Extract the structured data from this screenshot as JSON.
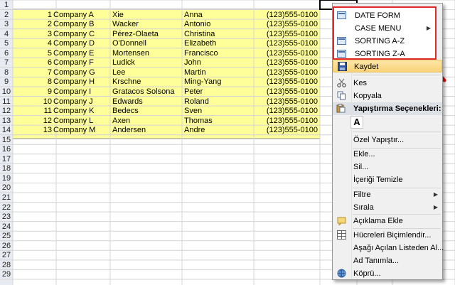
{
  "rows": [
    {
      "num": "1",
      "company": "Company A",
      "last": "Xie",
      "first": "Anna",
      "phone": "(123)555-0100"
    },
    {
      "num": "2",
      "company": "Company B",
      "last": "Wacker",
      "first": "Antonio",
      "phone": "(123)555-0100"
    },
    {
      "num": "3",
      "company": "Company C",
      "last": "Pérez-Olaeta",
      "first": "Christina",
      "phone": "(123)555-0100"
    },
    {
      "num": "4",
      "company": "Company D",
      "last": "O'Donnell",
      "first": "Elizabeth",
      "phone": "(123)555-0100"
    },
    {
      "num": "5",
      "company": "Company E",
      "last": "Mortensen",
      "first": "Francisco",
      "phone": "(123)555-0100"
    },
    {
      "num": "6",
      "company": "Company F",
      "last": "Ludick",
      "first": "John",
      "phone": "(123)555-0100"
    },
    {
      "num": "7",
      "company": "Company G",
      "last": "Lee",
      "first": "Martin",
      "phone": "(123)555-0100"
    },
    {
      "num": "8",
      "company": "Company H",
      "last": "Krschne",
      "first": "Ming-Yang",
      "phone": "(123)555-0100"
    },
    {
      "num": "9",
      "company": "Company I",
      "last": "Gratacos Solsona",
      "first": "Peter",
      "phone": "(123)555-0100"
    },
    {
      "num": "10",
      "company": "Company J",
      "last": "Edwards",
      "first": "Roland",
      "phone": "(123)555-0100"
    },
    {
      "num": "11",
      "company": "Company K",
      "last": "Bedecs",
      "first": "Sven",
      "phone": "(123)555-0100"
    },
    {
      "num": "12",
      "company": "Company L",
      "last": "Axen",
      "first": "Thomas",
      "phone": "(123)555-0100"
    },
    {
      "num": "13",
      "company": "Company M",
      "last": "Andersen",
      "first": "Andre",
      "phone": "(123)555-0100"
    }
  ],
  "row_numbers": [
    "1",
    "2",
    "3",
    "4",
    "5",
    "6",
    "7",
    "8",
    "9",
    "10",
    "11",
    "12",
    "13",
    "14",
    "15",
    "16",
    "17",
    "18",
    "19",
    "20",
    "21",
    "22",
    "23",
    "24",
    "25",
    "26",
    "27",
    "28",
    "29"
  ],
  "custom_menu": {
    "items": [
      "DATE FORM",
      "CASE MENU",
      "SORTING A-Z",
      "SORTING Z-A"
    ]
  },
  "context_menu": {
    "save": "Kaydet",
    "cut": "Kes",
    "copy": "Kopyala",
    "paste_options": "Yapıştırma Seçenekleri:",
    "paste_special": "Özel Yapıştır...",
    "insert": "Ekle...",
    "delete": "Sil...",
    "clear_contents": "İçeriği Temizle",
    "filter": "Filtre",
    "sort": "Sırala",
    "insert_comment": "Açıklama Ekle",
    "format_cells": "Hücreleri Biçimlendir...",
    "pick_from_list": "Aşağı Açılan Listeden Al...",
    "define_name": "Ad Tanımla...",
    "hyperlink": "Köprü..."
  },
  "colors": {
    "data_fill": "#ffff99",
    "highlight_border": "#e02a2a",
    "arrow": "#e8100c",
    "grid": "#d4d4d4"
  },
  "icons": {
    "save": "save-icon",
    "cut": "scissors-icon",
    "copy": "copy-icon",
    "paste": "paste-icon",
    "paste_option_a": "paste-values-icon",
    "comment": "comment-icon",
    "format_cells": "format-cells-icon",
    "hyperlink": "globe-link-icon",
    "form": "form-icon",
    "pointer": "red-arrow-icon"
  }
}
